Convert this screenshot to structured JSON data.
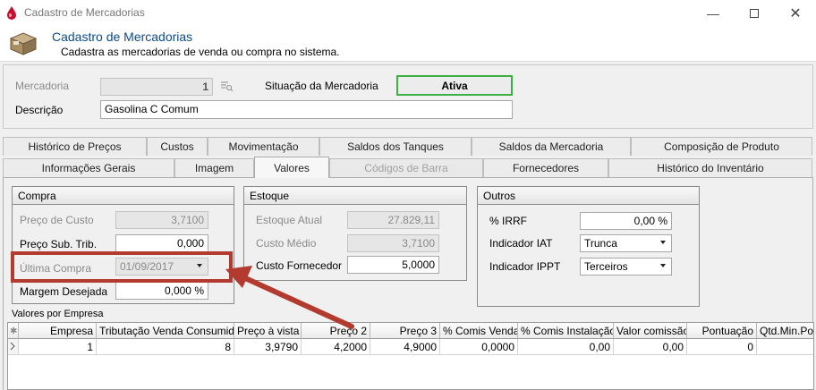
{
  "window": {
    "title": "Cadastro de Mercadorias"
  },
  "header": {
    "title": "Cadastro de Mercadorias",
    "subtitle": "Cadastra as mercadorias de venda ou compra no sistema."
  },
  "form": {
    "mercadoria_label": "Mercadoria",
    "mercadoria_value": "1",
    "situacao_label": "Situação da Mercadoria",
    "situacao_value": "Ativa",
    "descricao_label": "Descrição",
    "descricao_value": "Gasolina C Comum"
  },
  "tabs_row1": [
    "Histórico de Preços",
    "Custos",
    "Movimentação",
    "Saldos dos Tanques",
    "Saldos da Mercadoria",
    "Composição de Produto"
  ],
  "tabs_row2": [
    "Informações Gerais",
    "Imagem",
    "Valores",
    "Códigos de Barra",
    "Fornecedores",
    "Histórico do Inventário"
  ],
  "active_tab": "Valores",
  "compra": {
    "title": "Compra",
    "preco_custo_label": "Preço de Custo",
    "preco_custo_value": "3,7100",
    "preco_sub_label": "Preço Sub. Trib.",
    "preco_sub_value": "0,000",
    "ultima_compra_label": "Última Compra",
    "ultima_compra_value": "01/09/2017",
    "margem_label": "Margem Desejada",
    "margem_value": "0,000 %"
  },
  "estoque": {
    "title": "Estoque",
    "atual_label": "Estoque Atual",
    "atual_value": "27.829,11",
    "medio_label": "Custo Médio",
    "medio_value": "3,7100",
    "fornecedor_label": "Custo Fornecedor",
    "fornecedor_value": "5,0000"
  },
  "outros": {
    "title": "Outros",
    "irrf_label": "% IRRF",
    "irrf_value": "0,00 %",
    "iat_label": "Indicador IAT",
    "iat_value": "Trunca",
    "ippt_label": "Indicador IPPT",
    "ippt_value": "Terceiros"
  },
  "valores_empresa": {
    "title": "Valores por Empresa",
    "columns": [
      "Empresa",
      "Tributação Venda Consumidor",
      "Preço à vista",
      "Preço 2",
      "Preço 3",
      "% Comis Venda",
      "% Comis Instalação",
      "Valor comissão",
      "Pontuação",
      "Qtd.Min.Po"
    ],
    "rows": [
      [
        "1",
        "8",
        "3,9790",
        "4,2000",
        "4,9000",
        "0,0000",
        "0,00",
        "0,00",
        "0",
        ""
      ]
    ]
  },
  "colors": {
    "highlight_box": "#b23a2e",
    "arrow": "#b23a2e",
    "active_status_border": "#3cb043",
    "header_title": "#0b4a8c"
  }
}
